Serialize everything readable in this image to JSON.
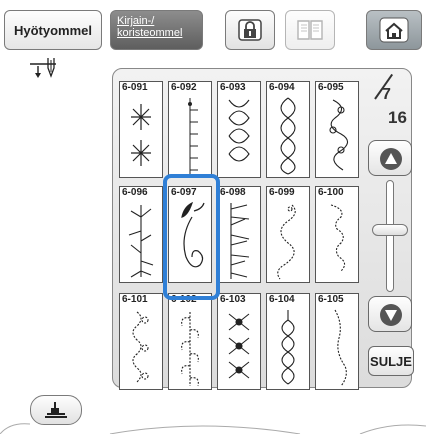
{
  "tabs": {
    "utility_label": "Hyötyommel",
    "character_line1": "Kirjain-/",
    "character_line2": "koristeommel"
  },
  "page": {
    "current": "7",
    "total": "16"
  },
  "close_label": "SULJE",
  "icons": {
    "lock": "lock-icon",
    "book": "book-icon",
    "home": "home-icon",
    "needle": "needle-position-icon",
    "presser_foot": "presser-foot-icon",
    "up": "triangle-up-icon",
    "down": "triangle-down-icon"
  },
  "stitches": [
    {
      "code": "6-091"
    },
    {
      "code": "6-092"
    },
    {
      "code": "6-093"
    },
    {
      "code": "6-094"
    },
    {
      "code": "6-095"
    },
    {
      "code": "6-096"
    },
    {
      "code": "6-097"
    },
    {
      "code": "6-098"
    },
    {
      "code": "6-099"
    },
    {
      "code": "6-100"
    },
    {
      "code": "6-101"
    },
    {
      "code": "6-102"
    },
    {
      "code": "6-103"
    },
    {
      "code": "6-104"
    },
    {
      "code": "6-105"
    }
  ],
  "selected": "6-097",
  "colors": {
    "selection": "#2f7fd6",
    "active_tab": "#6e6e6e"
  }
}
